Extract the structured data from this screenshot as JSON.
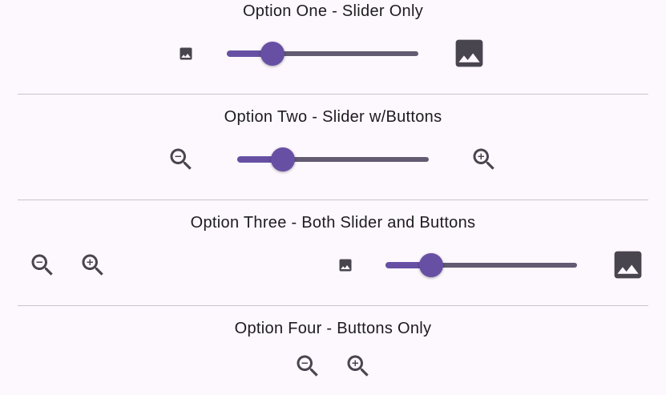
{
  "sections": [
    {
      "title": "Option One - Slider Only",
      "slider_value": 0.24
    },
    {
      "title": "Option Two - Slider w/Buttons",
      "slider_value": 0.24
    },
    {
      "title": "Option Three - Both Slider and Buttons",
      "slider_value": 0.24
    },
    {
      "title": "Option Four - Buttons Only"
    }
  ],
  "icons": {
    "small_image": "image-icon",
    "large_image": "image-icon",
    "zoom_out": "zoom-out-icon",
    "zoom_in": "zoom-in-icon"
  },
  "colors": {
    "background": "#fdf7fe",
    "accent": "#6750a4",
    "track": "#625b71",
    "icon": "#49454f",
    "divider": "#cac4cf"
  }
}
